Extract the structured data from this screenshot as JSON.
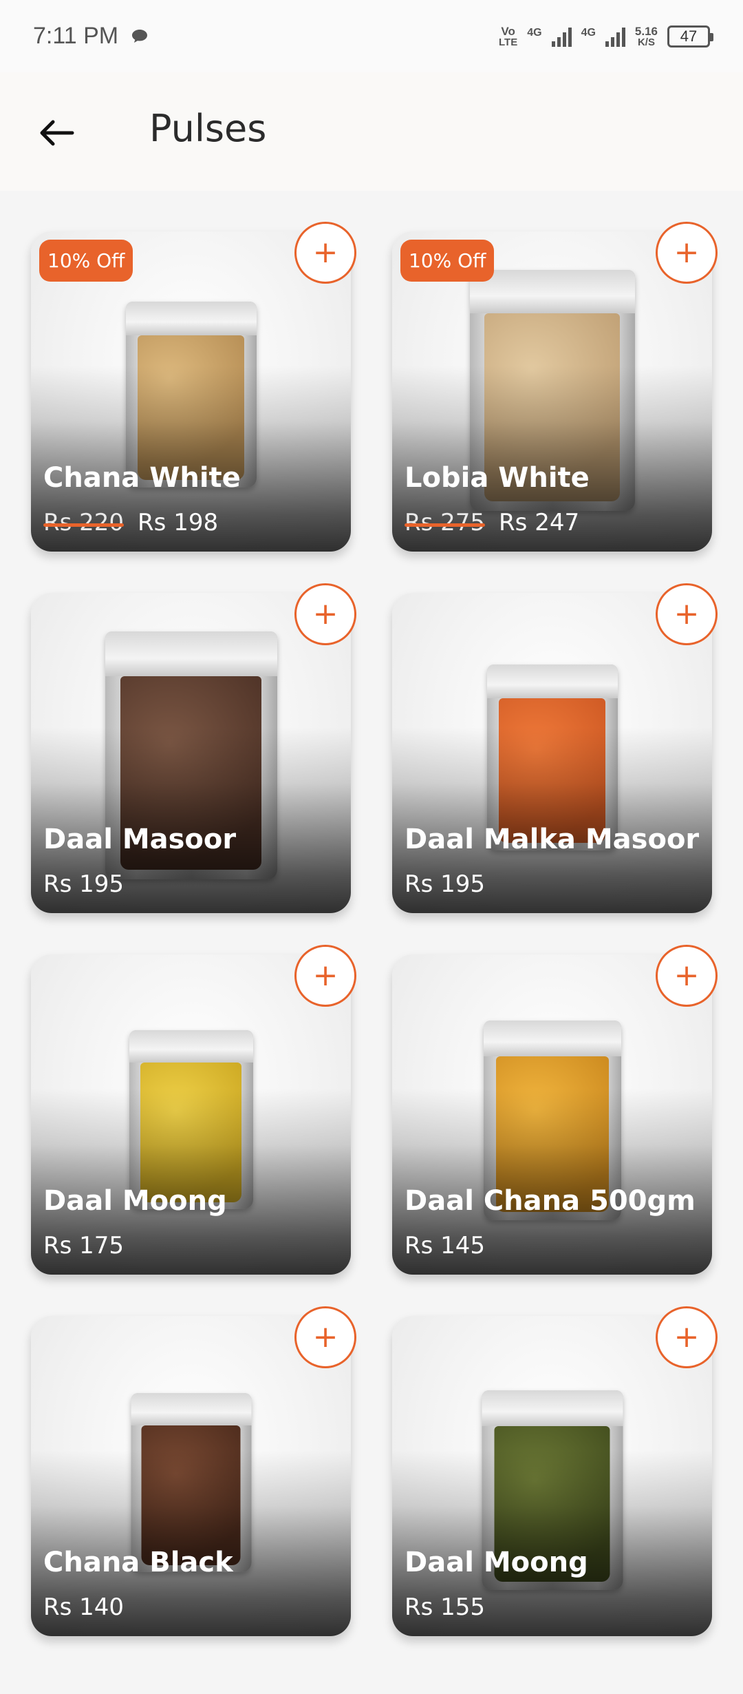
{
  "status_bar": {
    "time": "7:11 PM",
    "volte_top": "Vo",
    "volte_bottom": "LTE",
    "net1": "4G",
    "net2": "4G",
    "speed_top": "5.16",
    "speed_bottom": "K/S",
    "battery": "47"
  },
  "header": {
    "title": "Pulses"
  },
  "colors": {
    "accent": "#e8632b"
  },
  "products": [
    {
      "name": "Chana White",
      "old_price": "Rs 220",
      "price": "Rs 198",
      "badge": "10% Off",
      "fill": "#c9a46a"
    },
    {
      "name": "Lobia White",
      "old_price": "Rs 275",
      "price": "Rs 247",
      "badge": "10% Off",
      "fill": "#cdb08a"
    },
    {
      "name": "Daal Masoor",
      "old_price": "",
      "price": "Rs 195",
      "badge": "",
      "fill": "#6b4a3a"
    },
    {
      "name": "Daal Malka Masoor",
      "old_price": "",
      "price": "Rs 195",
      "badge": "",
      "fill": "#e06a30"
    },
    {
      "name": "Daal Moong",
      "old_price": "",
      "price": "Rs 175",
      "badge": "",
      "fill": "#e0c238"
    },
    {
      "name": "Daal Chana 500gm",
      "old_price": "",
      "price": "Rs 145",
      "badge": "",
      "fill": "#e3a530"
    },
    {
      "name": "Chana Black",
      "old_price": "",
      "price": "Rs 140",
      "badge": "",
      "fill": "#6a3f2c"
    },
    {
      "name": "Daal Moong",
      "old_price": "",
      "price": "Rs 155",
      "badge": "",
      "fill": "#5e6a2e"
    }
  ]
}
